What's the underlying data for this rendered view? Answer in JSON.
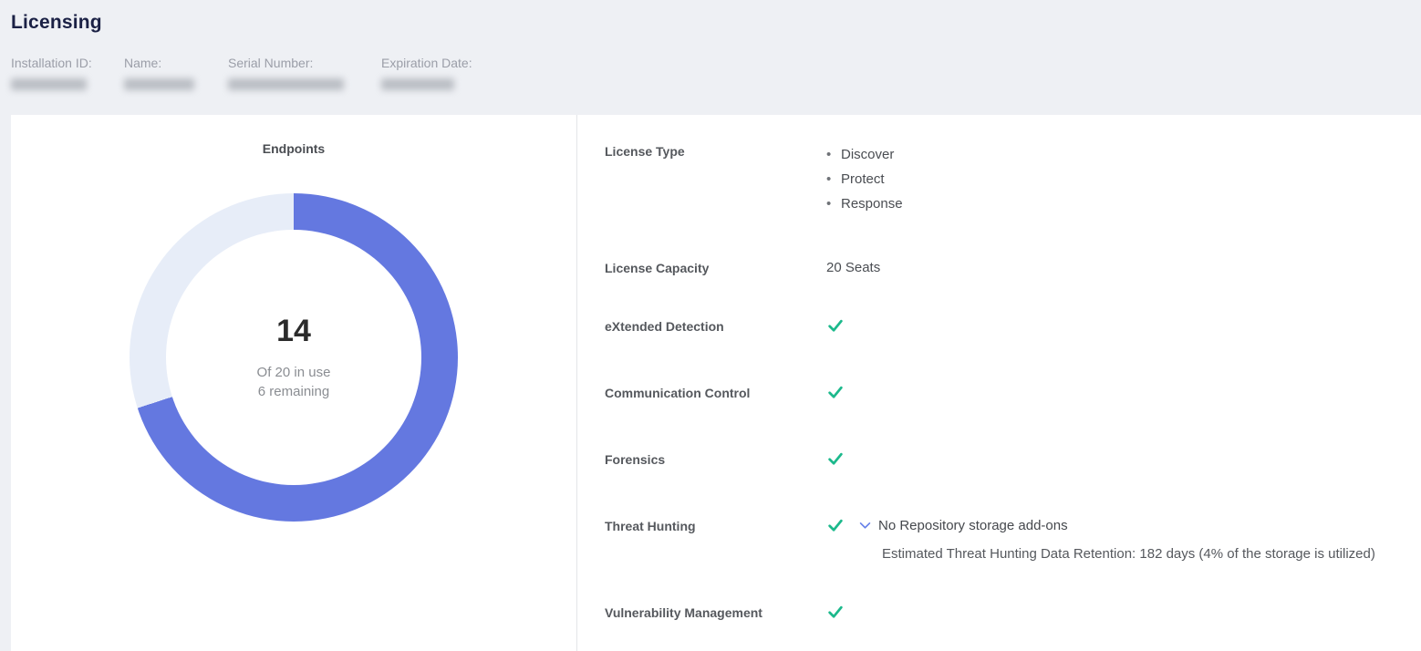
{
  "header": {
    "title": "Licensing",
    "meta": [
      {
        "label": "Installation ID:"
      },
      {
        "label": "Name:"
      },
      {
        "label": "Serial Number:"
      },
      {
        "label": "Expiration Date:"
      }
    ],
    "values_redacted": true
  },
  "chart_data": {
    "type": "pie",
    "subtype": "donut",
    "title": "Endpoints",
    "series": [
      {
        "name": "In use",
        "value": 14,
        "color": "#6478e0"
      },
      {
        "name": "Remaining",
        "value": 6,
        "color": "#e7edf8"
      }
    ],
    "total_seats": 20,
    "center_value": "14",
    "center_line1": "Of 20 in use",
    "center_line2": "6 remaining",
    "start_angle_deg": 0,
    "direction": "clockwise",
    "legend": "none"
  },
  "license": {
    "rows": [
      {
        "label": "License Type",
        "items": [
          "Discover",
          "Protect",
          "Response"
        ]
      },
      {
        "label": "License Capacity",
        "value": "20 Seats"
      },
      {
        "label": "eXtended Detection",
        "checked": true
      },
      {
        "label": "Communication Control",
        "checked": true
      },
      {
        "label": "Forensics",
        "checked": true
      },
      {
        "label": "Threat Hunting",
        "checked": true,
        "expand_label": "No Repository storage add-ons",
        "detail": "Estimated Threat Hunting Data Retention: 182 days (4% of the storage is utilized)"
      },
      {
        "label": "Vulnerability Management",
        "checked": true
      }
    ]
  },
  "colors": {
    "page_bg": "#eef0f4",
    "panel_bg": "#ffffff",
    "title": "#1b2145",
    "donut_used": "#6478e0",
    "donut_remaining": "#e7edf8",
    "check": "#1cb98c",
    "chevron": "#6680e8"
  }
}
